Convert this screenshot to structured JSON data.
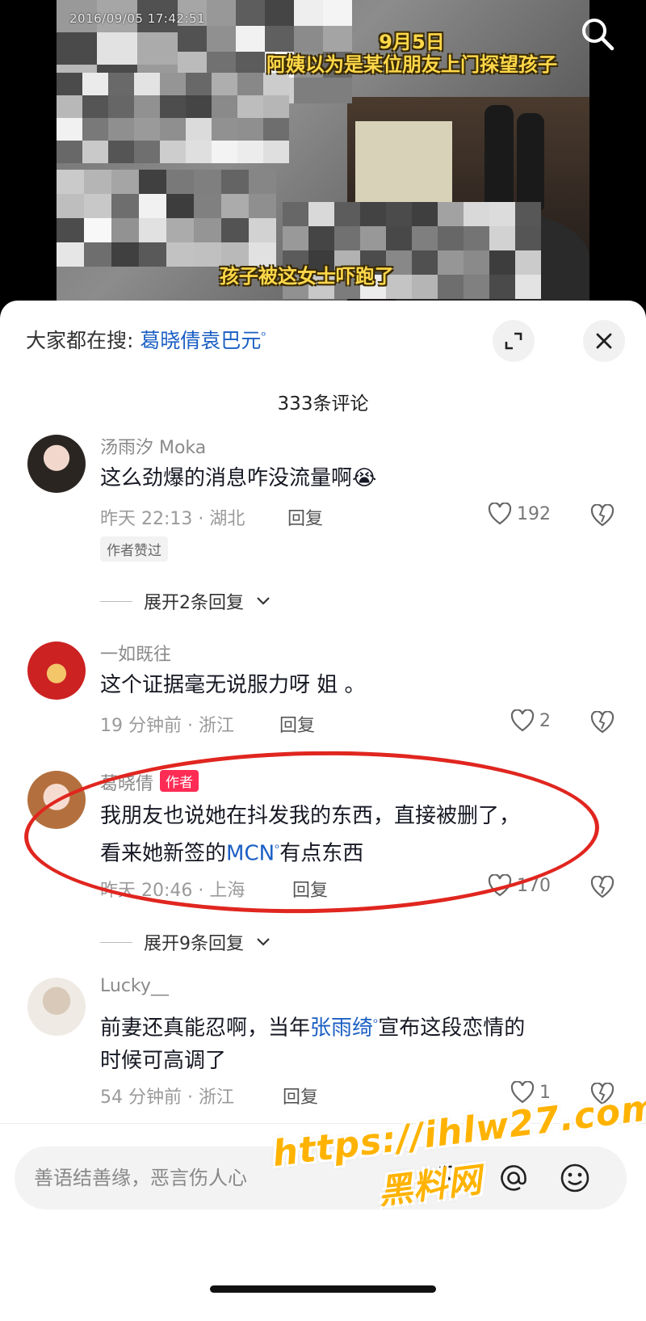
{
  "video": {
    "timestamp": "2016/09/05  17:42:51",
    "caption_date": "9月5日",
    "caption_top": "阿姨以为是某位朋友上门探望孩子",
    "caption_bottom": "孩子被这女士吓跑了"
  },
  "search_suggest": {
    "prefix": "大家都在搜:",
    "keyword": "葛晓倩袁巴元"
  },
  "comments_title": "333条评论",
  "comments": [
    {
      "name": "汤雨汐 Moka",
      "text": "这么劲爆的消息咋没流量啊😭",
      "meta": "昨天 22:13 · 湖北",
      "reply": "回复",
      "likes": "192",
      "badge": "作者赞过",
      "expand": "展开2条回复"
    },
    {
      "name": "一如既往",
      "text": "这个证据毫无说服力呀 姐 。",
      "meta": "19 分钟前 · 浙江",
      "reply": "回复",
      "likes": "2"
    },
    {
      "name": "葛晓倩",
      "author_tag": "作者",
      "text_line1": "我朋友也说她在抖发我的东西，直接被删了，",
      "text_line2_pre": "看来她新签的",
      "text_line2_kw": "MCN",
      "text_line2_post": "有点东西",
      "meta": "昨天 20:46 · 上海",
      "reply": "回复",
      "likes": "170",
      "expand": "展开9条回复"
    },
    {
      "name": "Lucky__",
      "text_line1_pre": "前妻还真能忍啊，当年",
      "text_line1_kw": "张雨绮",
      "text_line1_post": "宣布这段恋情的",
      "text_line2": "时候可高调了",
      "meta": "54 分钟前 · 浙江",
      "reply": "回复",
      "likes": "1"
    }
  ],
  "input": {
    "placeholder": "善语结善缘，恶言伤人心"
  },
  "watermark": {
    "url": "https://ihlw27.com",
    "site": "黑料网"
  },
  "colors": {
    "link": "#1b5fc4",
    "author_tag": "#fe2c55",
    "circle": "#e0261f",
    "caption": "#ffd84a"
  }
}
